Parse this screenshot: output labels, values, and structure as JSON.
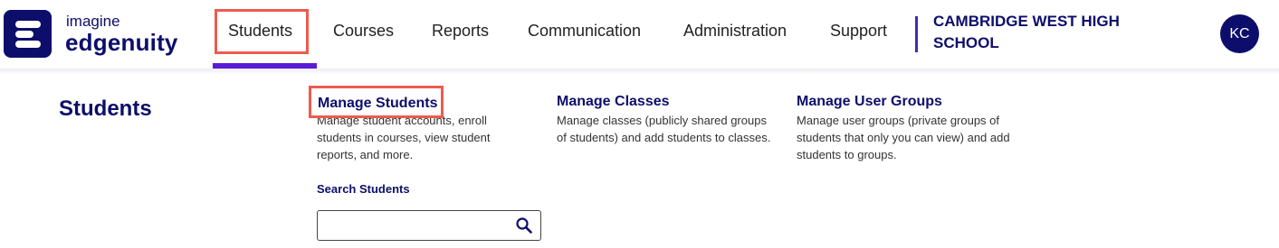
{
  "brand": {
    "line1": "imagine",
    "line2": "edgenuity"
  },
  "nav": {
    "items": [
      {
        "label": "Students",
        "active": true
      },
      {
        "label": "Courses"
      },
      {
        "label": "Reports"
      },
      {
        "label": "Communication"
      },
      {
        "label": "Administration"
      },
      {
        "label": "Support"
      }
    ]
  },
  "school": {
    "name": "CAMBRIDGE WEST HIGH SCHOOL"
  },
  "user": {
    "initials": "KC"
  },
  "section": {
    "title": "Students"
  },
  "menu": {
    "columns": [
      {
        "title": "Manage Students",
        "description": "Manage student accounts, enroll students in courses, view student reports, and more."
      },
      {
        "title": "Manage Classes",
        "description": "Manage classes (publicly shared groups of students) and add students to classes."
      },
      {
        "title": "Manage User Groups",
        "description": "Manage user groups (private groups of students that only you can view) and add students to groups."
      }
    ]
  },
  "search": {
    "label": "Search Students",
    "value": "",
    "icon": "search-icon"
  },
  "colors": {
    "brand_navy": "#0d0d6b",
    "highlight": "#ee5a4f",
    "active_underline": "#5a1bd6"
  }
}
